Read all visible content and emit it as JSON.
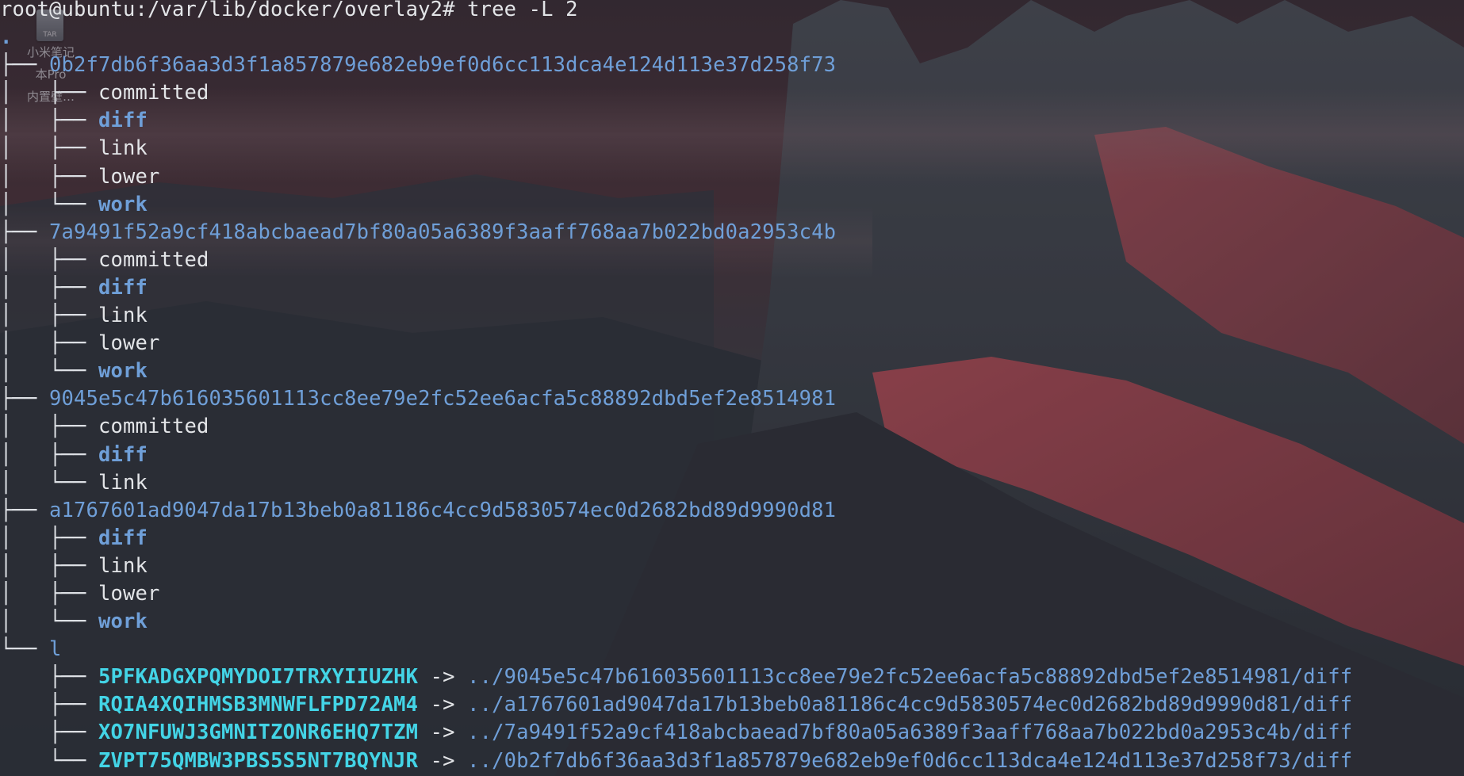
{
  "desktop": {
    "icon_badge": "TAR",
    "icon_label_lines": [
      "小米笔记",
      "本Pro",
      "内置壁…"
    ]
  },
  "terminal": {
    "prompt": "root@ubuntu:/var/lib/docker/overlay2#",
    "command": "tree -L 2",
    "root": ".",
    "lines": [
      {
        "tree": "├── ",
        "text": "0b2f7db6f36aa3d3f1a857879e682eb9ef0d6cc113dca4e124d113e37d258f73",
        "kind": "dir"
      },
      {
        "tree": "│   ├── ",
        "text": "committed",
        "kind": "file"
      },
      {
        "tree": "│   ├── ",
        "text": "diff",
        "kind": "dirb"
      },
      {
        "tree": "│   ├── ",
        "text": "link",
        "kind": "file"
      },
      {
        "tree": "│   ├── ",
        "text": "lower",
        "kind": "file"
      },
      {
        "tree": "│   └── ",
        "text": "work",
        "kind": "dirb"
      },
      {
        "tree": "├── ",
        "text": "7a9491f52a9cf418abcbaead7bf80a05a6389f3aaff768aa7b022bd0a2953c4b",
        "kind": "dir"
      },
      {
        "tree": "│   ├── ",
        "text": "committed",
        "kind": "file"
      },
      {
        "tree": "│   ├── ",
        "text": "diff",
        "kind": "dirb"
      },
      {
        "tree": "│   ├── ",
        "text": "link",
        "kind": "file"
      },
      {
        "tree": "│   ├── ",
        "text": "lower",
        "kind": "file"
      },
      {
        "tree": "│   └── ",
        "text": "work",
        "kind": "dirb"
      },
      {
        "tree": "├── ",
        "text": "9045e5c47b616035601113cc8ee79e2fc52ee6acfa5c88892dbd5ef2e8514981",
        "kind": "dir"
      },
      {
        "tree": "│   ├── ",
        "text": "committed",
        "kind": "file"
      },
      {
        "tree": "│   ├── ",
        "text": "diff",
        "kind": "dirb"
      },
      {
        "tree": "│   └── ",
        "text": "link",
        "kind": "file"
      },
      {
        "tree": "├── ",
        "text": "a1767601ad9047da17b13beb0a81186c4cc9d5830574ec0d2682bd89d9990d81",
        "kind": "dir"
      },
      {
        "tree": "│   ├── ",
        "text": "diff",
        "kind": "dirb"
      },
      {
        "tree": "│   ├── ",
        "text": "link",
        "kind": "file"
      },
      {
        "tree": "│   ├── ",
        "text": "lower",
        "kind": "file"
      },
      {
        "tree": "│   └── ",
        "text": "work",
        "kind": "dirb"
      },
      {
        "tree": "└── ",
        "text": "l",
        "kind": "dir"
      },
      {
        "tree": "    ├── ",
        "text": "5PFKADGXPQMYDOI7TRXYIIUZHK",
        "kind": "link",
        "arrow": " -> ",
        "target": "../9045e5c47b616035601113cc8ee79e2fc52ee6acfa5c88892dbd5ef2e8514981/diff"
      },
      {
        "tree": "    ├── ",
        "text": "RQIA4XQIHMSB3MNWFLFPD72AM4",
        "kind": "link",
        "arrow": " -> ",
        "target": "../a1767601ad9047da17b13beb0a81186c4cc9d5830574ec0d2682bd89d9990d81/diff"
      },
      {
        "tree": "    ├── ",
        "text": "XO7NFUWJ3GMNITZONR6EHQ7TZM",
        "kind": "link",
        "arrow": " -> ",
        "target": "../7a9491f52a9cf418abcbaead7bf80a05a6389f3aaff768aa7b022bd0a2953c4b/diff"
      },
      {
        "tree": "    └── ",
        "text": "ZVPT75QMBW3PBS5S5NT7BQYNJR",
        "kind": "link",
        "arrow": " -> ",
        "target": "../0b2f7db6f36aa3d3f1a857879e682eb9ef0d6cc113dca4e124d113e37d258f73/diff"
      }
    ]
  },
  "colors": {
    "dir": "#6f9fd8",
    "symlink": "#43d4e6",
    "text": "#e3e5e8"
  }
}
